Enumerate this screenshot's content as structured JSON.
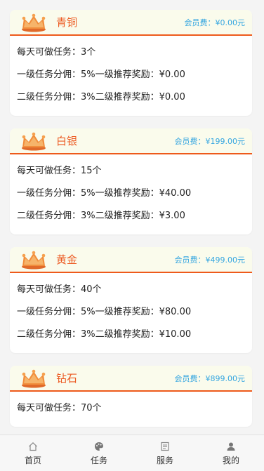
{
  "levels": [
    {
      "name": "青铜",
      "fee": "会员费：¥0.00元",
      "daily": "每天可做任务：3个",
      "l1": "一级任务分佣：5%一级推荐奖励：¥0.00",
      "l2": "二级任务分佣：3%二级推荐奖励：¥0.00"
    },
    {
      "name": "白银",
      "fee": "会员费：¥199.00元",
      "daily": "每天可做任务：15个",
      "l1": "一级任务分佣：5%一级推荐奖励：¥40.00",
      "l2": "二级任务分佣：3%二级推荐奖励：¥3.00"
    },
    {
      "name": "黄金",
      "fee": "会员费：¥499.00元",
      "daily": "每天可做任务：40个",
      "l1": "一级任务分佣：5%一级推荐奖励：¥80.00",
      "l2": "二级任务分佣：3%二级推荐奖励：¥10.00"
    },
    {
      "name": "钻石",
      "fee": "会员费：¥899.00元",
      "daily": "每天可做任务：70个",
      "l1": "",
      "l2": ""
    }
  ],
  "tabs": [
    {
      "label": "首页",
      "icon": "home-icon"
    },
    {
      "label": "任务",
      "icon": "palette-icon"
    },
    {
      "label": "服务",
      "icon": "document-icon"
    },
    {
      "label": "我的",
      "icon": "user-icon"
    }
  ],
  "colors": {
    "accent": "#ee5a1b",
    "fee": "#35a6e0",
    "header_bg": "#fafbec"
  }
}
